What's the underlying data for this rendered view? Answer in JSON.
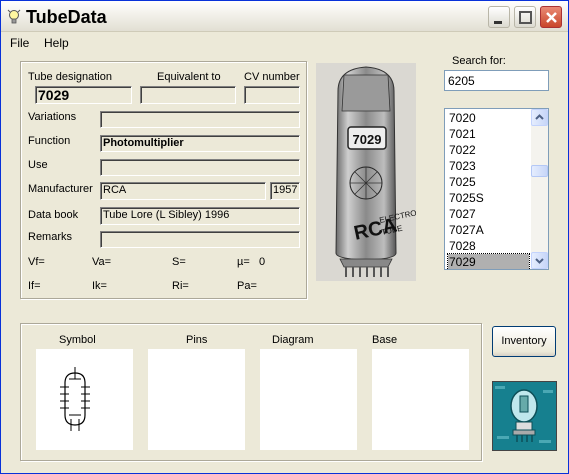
{
  "window": {
    "title": "TubeData"
  },
  "menu": {
    "file": "File",
    "help": "Help"
  },
  "fields": {
    "tube_designation_label": "Tube designation",
    "tube_designation": "7029",
    "equivalent_label": "Equivalent to",
    "equivalent": "",
    "cv_label": "CV number",
    "cv": "",
    "variations_label": "Variations",
    "variations": "",
    "function_label": "Function",
    "function": "Photomultiplier",
    "use_label": "Use",
    "use": "",
    "manufacturer_label": "Manufacturer",
    "manufacturer": "RCA",
    "year": "1957",
    "databook_label": "Data book",
    "databook": "Tube Lore (L Sibley) 1996",
    "remarks_label": "Remarks",
    "remarks": ""
  },
  "params": {
    "vf": "Vf=",
    "va": "Va=",
    "s": "S=",
    "mu": "µ=",
    "mu_value": "0",
    "if": "If=",
    "ik": "Ik=",
    "ri": "Ri=",
    "pa": "Pa="
  },
  "search": {
    "label": "Search for:",
    "value": "6205"
  },
  "tube_list": [
    "7020",
    "7021",
    "7022",
    "7023",
    "7025",
    "7025S",
    "7027",
    "7027A",
    "7028",
    "7029"
  ],
  "selected_tube": "7029",
  "panels": {
    "symbol": "Symbol",
    "pins": "Pins",
    "diagram": "Diagram",
    "base": "Base"
  },
  "inventory_button": "Inventory",
  "tube_photo_text": {
    "code": "7029",
    "brand": "RCA",
    "line1": "ELECTRON",
    "line2": "TUBE"
  },
  "colors": {
    "titlebar_close": "#c9462a",
    "form_bg": "#ece9d8",
    "input_border": "#7f9db9"
  }
}
